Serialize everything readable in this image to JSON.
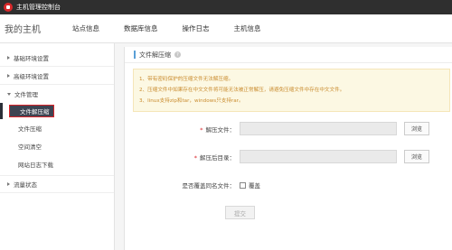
{
  "titlebar": {
    "title": "主机管理控制台",
    "logo_icon": "huawei-logo-icon"
  },
  "navbar": {
    "brand": "我的主机",
    "items": [
      "站点信息",
      "数据库信息",
      "操作日志",
      "主机信息"
    ]
  },
  "sidebar": {
    "groups": [
      {
        "label": "基础环境设置"
      },
      {
        "label": "高级环境设置"
      },
      {
        "label": "文件管理"
      }
    ],
    "file_items": [
      {
        "label": "文件解压缩"
      },
      {
        "label": "文件压缩"
      },
      {
        "label": "空间清空"
      },
      {
        "label": "网站日志下载"
      }
    ],
    "traffic": {
      "label": "流量状态"
    }
  },
  "panel": {
    "title": "文件解压缩",
    "notice": [
      "1、带有密码保护的压缩文件无法解压缩。",
      "2、压缩文件中如果存在中文文件将可能无法被正常解压，请避免压缩文件中存在中文文件。",
      "3、linux支持zip和tar，windows只支持rar。"
    ],
    "form": {
      "file_label": "解压文件：",
      "target_label": "解压后目录：",
      "browse": "浏览",
      "overwrite_label": "是否覆盖同名文件：",
      "overwrite_option": "覆盖",
      "submit": "提交"
    }
  },
  "colors": {
    "accent": "#d9252a",
    "active_bg": "#3d4452",
    "notice_text": "#c98b2e"
  }
}
